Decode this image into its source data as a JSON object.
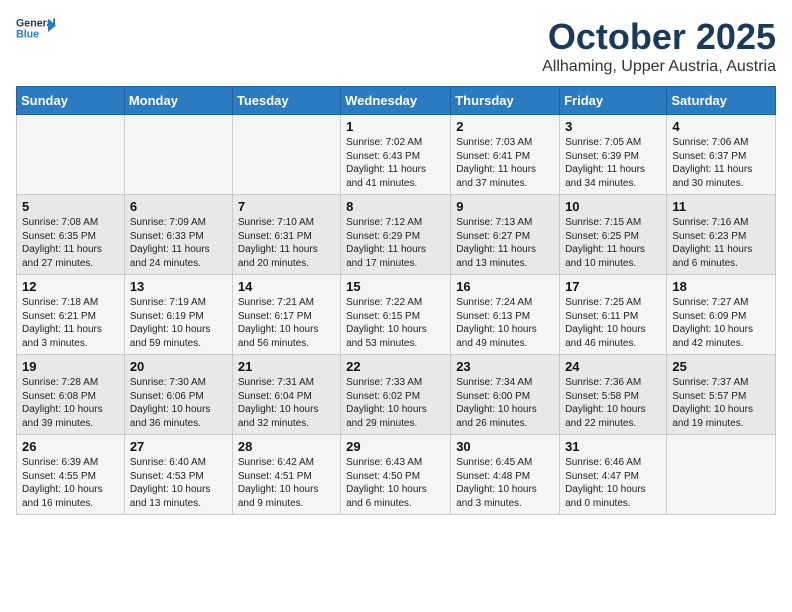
{
  "header": {
    "logo_line1": "General",
    "logo_line2": "Blue",
    "title": "October 2025",
    "subtitle": "Allhaming, Upper Austria, Austria"
  },
  "weekdays": [
    "Sunday",
    "Monday",
    "Tuesday",
    "Wednesday",
    "Thursday",
    "Friday",
    "Saturday"
  ],
  "weeks": [
    [
      {
        "day": "",
        "info": ""
      },
      {
        "day": "",
        "info": ""
      },
      {
        "day": "",
        "info": ""
      },
      {
        "day": "1",
        "info": "Sunrise: 7:02 AM\nSunset: 6:43 PM\nDaylight: 11 hours\nand 41 minutes."
      },
      {
        "day": "2",
        "info": "Sunrise: 7:03 AM\nSunset: 6:41 PM\nDaylight: 11 hours\nand 37 minutes."
      },
      {
        "day": "3",
        "info": "Sunrise: 7:05 AM\nSunset: 6:39 PM\nDaylight: 11 hours\nand 34 minutes."
      },
      {
        "day": "4",
        "info": "Sunrise: 7:06 AM\nSunset: 6:37 PM\nDaylight: 11 hours\nand 30 minutes."
      }
    ],
    [
      {
        "day": "5",
        "info": "Sunrise: 7:08 AM\nSunset: 6:35 PM\nDaylight: 11 hours\nand 27 minutes."
      },
      {
        "day": "6",
        "info": "Sunrise: 7:09 AM\nSunset: 6:33 PM\nDaylight: 11 hours\nand 24 minutes."
      },
      {
        "day": "7",
        "info": "Sunrise: 7:10 AM\nSunset: 6:31 PM\nDaylight: 11 hours\nand 20 minutes."
      },
      {
        "day": "8",
        "info": "Sunrise: 7:12 AM\nSunset: 6:29 PM\nDaylight: 11 hours\nand 17 minutes."
      },
      {
        "day": "9",
        "info": "Sunrise: 7:13 AM\nSunset: 6:27 PM\nDaylight: 11 hours\nand 13 minutes."
      },
      {
        "day": "10",
        "info": "Sunrise: 7:15 AM\nSunset: 6:25 PM\nDaylight: 11 hours\nand 10 minutes."
      },
      {
        "day": "11",
        "info": "Sunrise: 7:16 AM\nSunset: 6:23 PM\nDaylight: 11 hours\nand 6 minutes."
      }
    ],
    [
      {
        "day": "12",
        "info": "Sunrise: 7:18 AM\nSunset: 6:21 PM\nDaylight: 11 hours\nand 3 minutes."
      },
      {
        "day": "13",
        "info": "Sunrise: 7:19 AM\nSunset: 6:19 PM\nDaylight: 10 hours\nand 59 minutes."
      },
      {
        "day": "14",
        "info": "Sunrise: 7:21 AM\nSunset: 6:17 PM\nDaylight: 10 hours\nand 56 minutes."
      },
      {
        "day": "15",
        "info": "Sunrise: 7:22 AM\nSunset: 6:15 PM\nDaylight: 10 hours\nand 53 minutes."
      },
      {
        "day": "16",
        "info": "Sunrise: 7:24 AM\nSunset: 6:13 PM\nDaylight: 10 hours\nand 49 minutes."
      },
      {
        "day": "17",
        "info": "Sunrise: 7:25 AM\nSunset: 6:11 PM\nDaylight: 10 hours\nand 46 minutes."
      },
      {
        "day": "18",
        "info": "Sunrise: 7:27 AM\nSunset: 6:09 PM\nDaylight: 10 hours\nand 42 minutes."
      }
    ],
    [
      {
        "day": "19",
        "info": "Sunrise: 7:28 AM\nSunset: 6:08 PM\nDaylight: 10 hours\nand 39 minutes."
      },
      {
        "day": "20",
        "info": "Sunrise: 7:30 AM\nSunset: 6:06 PM\nDaylight: 10 hours\nand 36 minutes."
      },
      {
        "day": "21",
        "info": "Sunrise: 7:31 AM\nSunset: 6:04 PM\nDaylight: 10 hours\nand 32 minutes."
      },
      {
        "day": "22",
        "info": "Sunrise: 7:33 AM\nSunset: 6:02 PM\nDaylight: 10 hours\nand 29 minutes."
      },
      {
        "day": "23",
        "info": "Sunrise: 7:34 AM\nSunset: 6:00 PM\nDaylight: 10 hours\nand 26 minutes."
      },
      {
        "day": "24",
        "info": "Sunrise: 7:36 AM\nSunset: 5:58 PM\nDaylight: 10 hours\nand 22 minutes."
      },
      {
        "day": "25",
        "info": "Sunrise: 7:37 AM\nSunset: 5:57 PM\nDaylight: 10 hours\nand 19 minutes."
      }
    ],
    [
      {
        "day": "26",
        "info": "Sunrise: 6:39 AM\nSunset: 4:55 PM\nDaylight: 10 hours\nand 16 minutes."
      },
      {
        "day": "27",
        "info": "Sunrise: 6:40 AM\nSunset: 4:53 PM\nDaylight: 10 hours\nand 13 minutes."
      },
      {
        "day": "28",
        "info": "Sunrise: 6:42 AM\nSunset: 4:51 PM\nDaylight: 10 hours\nand 9 minutes."
      },
      {
        "day": "29",
        "info": "Sunrise: 6:43 AM\nSunset: 4:50 PM\nDaylight: 10 hours\nand 6 minutes."
      },
      {
        "day": "30",
        "info": "Sunrise: 6:45 AM\nSunset: 4:48 PM\nDaylight: 10 hours\nand 3 minutes."
      },
      {
        "day": "31",
        "info": "Sunrise: 6:46 AM\nSunset: 4:47 PM\nDaylight: 10 hours\nand 0 minutes."
      },
      {
        "day": "",
        "info": ""
      }
    ]
  ]
}
